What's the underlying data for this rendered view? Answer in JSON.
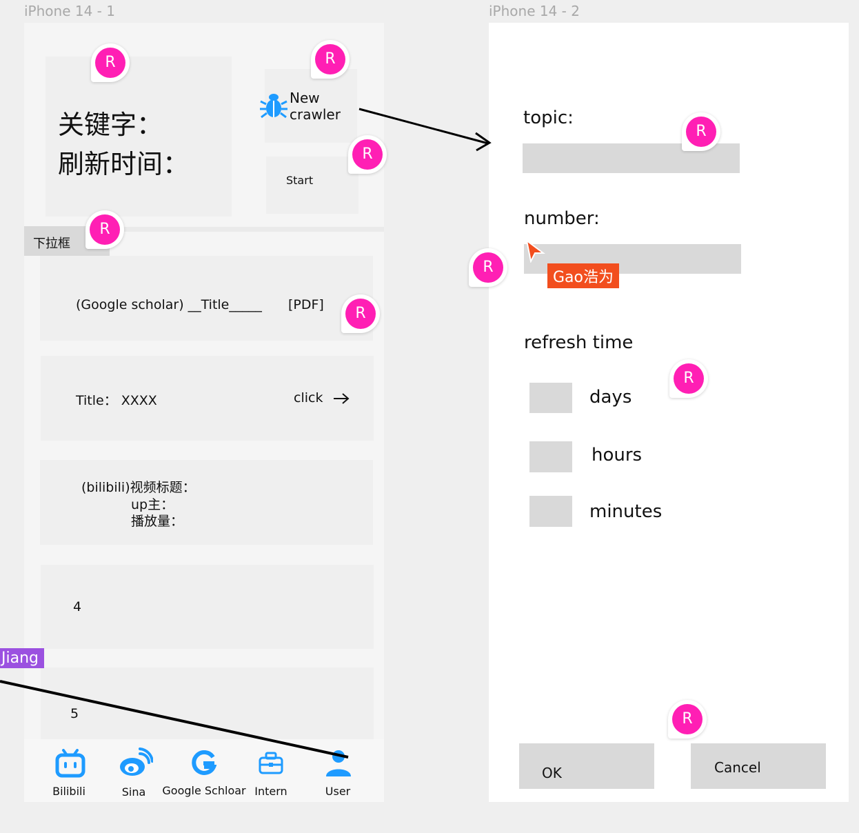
{
  "frames": {
    "left_label": "iPhone 14 - 1",
    "right_label": "iPhone 14 - 2"
  },
  "left": {
    "keyword_label": "关键字：",
    "refresh_label": "刷新时间：",
    "new_crawler": [
      "New",
      "crawler"
    ],
    "start_label": "Start",
    "dropdown_label": "下拉框",
    "cards": [
      {
        "text": "(Google scholar) __Title_____",
        "right": "[PDF]"
      },
      {
        "text": "Title： XXXX",
        "right": "click",
        "right_icon": "arrow-right-icon"
      },
      {
        "lines": [
          "(bilibili)视频标题：",
          "up主：",
          "播放量："
        ]
      },
      {
        "text": "4"
      },
      {
        "text": "5"
      }
    ],
    "tabs": [
      {
        "label": "Bilibili",
        "icon": "bilibili-icon"
      },
      {
        "label": "Sina",
        "icon": "weibo-icon"
      },
      {
        "label": "Google Schloar",
        "icon": "google-icon"
      },
      {
        "label": "Intern",
        "icon": "briefcase-icon"
      },
      {
        "label": "User",
        "icon": "user-icon"
      }
    ]
  },
  "right": {
    "topic_label": "topic:",
    "number_label": "number:",
    "refresh_time_label": "refresh time",
    "options": [
      "days",
      "hours",
      "minutes"
    ],
    "ok_label": "OK",
    "cancel_label": "Cancel"
  },
  "collaborators": {
    "comment_initial": "R",
    "cursor_gao": "Gao浩为",
    "cursor_jiang": "Jiang"
  },
  "colors": {
    "accent_blue": "#1e9bff",
    "comment_pink": "#ff1fb4",
    "cursor_gao": "#f24e1e",
    "cursor_jiang": "#9b51e0"
  }
}
